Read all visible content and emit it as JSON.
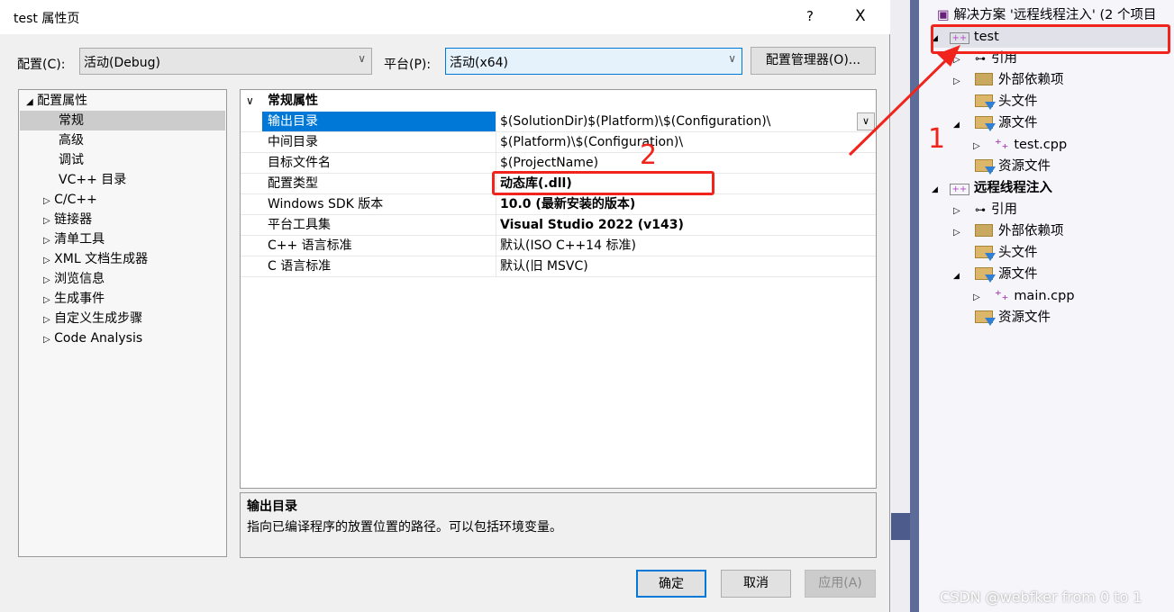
{
  "dialog": {
    "title": "test 属性页",
    "help": "?",
    "close": "X",
    "config_label": "配置(C):",
    "config_value": "活动(Debug)",
    "platform_label": "平台(P):",
    "platform_value": "活动(x64)",
    "config_manager": "配置管理器(O)..."
  },
  "tree": {
    "root": "配置属性",
    "items": [
      "常规",
      "高级",
      "调试",
      "VC++ 目录",
      "C/C++",
      "链接器",
      "清单工具",
      "XML 文档生成器",
      "浏览信息",
      "生成事件",
      "自定义生成步骤",
      "Code Analysis"
    ],
    "selected": "常规"
  },
  "grid": {
    "section": "常规属性",
    "rows": [
      {
        "key": "输出目录",
        "value": "$(SolutionDir)$(Platform)\\$(Configuration)\\"
      },
      {
        "key": "中间目录",
        "value": "$(Platform)\\$(Configuration)\\"
      },
      {
        "key": "目标文件名",
        "value": "$(ProjectName)"
      },
      {
        "key": "配置类型",
        "value": "动态库(.dll)",
        "bold": true
      },
      {
        "key": "Windows SDK 版本",
        "value": "10.0 (最新安装的版本)",
        "bold": true
      },
      {
        "key": "平台工具集",
        "value": "Visual Studio 2022 (v143)",
        "bold": true
      },
      {
        "key": "C++ 语言标准",
        "value": "默认(ISO C++14 标准)"
      },
      {
        "key": "C 语言标准",
        "value": "默认(旧 MSVC)"
      }
    ]
  },
  "description": {
    "title": "输出目录",
    "text": "指向已编译程序的放置位置的路径。可以包括环境变量。"
  },
  "buttons": {
    "ok": "确定",
    "cancel": "取消",
    "apply": "应用(A)"
  },
  "solution_explorer": {
    "solution": "解决方案 '远程线程注入' (2 个项目",
    "projects": [
      {
        "name": "test",
        "children": [
          "引用",
          "外部依赖项",
          "头文件",
          "源文件",
          "test.cpp",
          "资源文件"
        ]
      },
      {
        "name": "远程线程注入",
        "children": [
          "引用",
          "外部依赖项",
          "头文件",
          "源文件",
          "main.cpp",
          "资源文件"
        ]
      }
    ]
  },
  "annotations": {
    "one": "1",
    "two": "2",
    "color": "#f0241c"
  },
  "watermark": "CSDN @webfker from 0 to 1"
}
